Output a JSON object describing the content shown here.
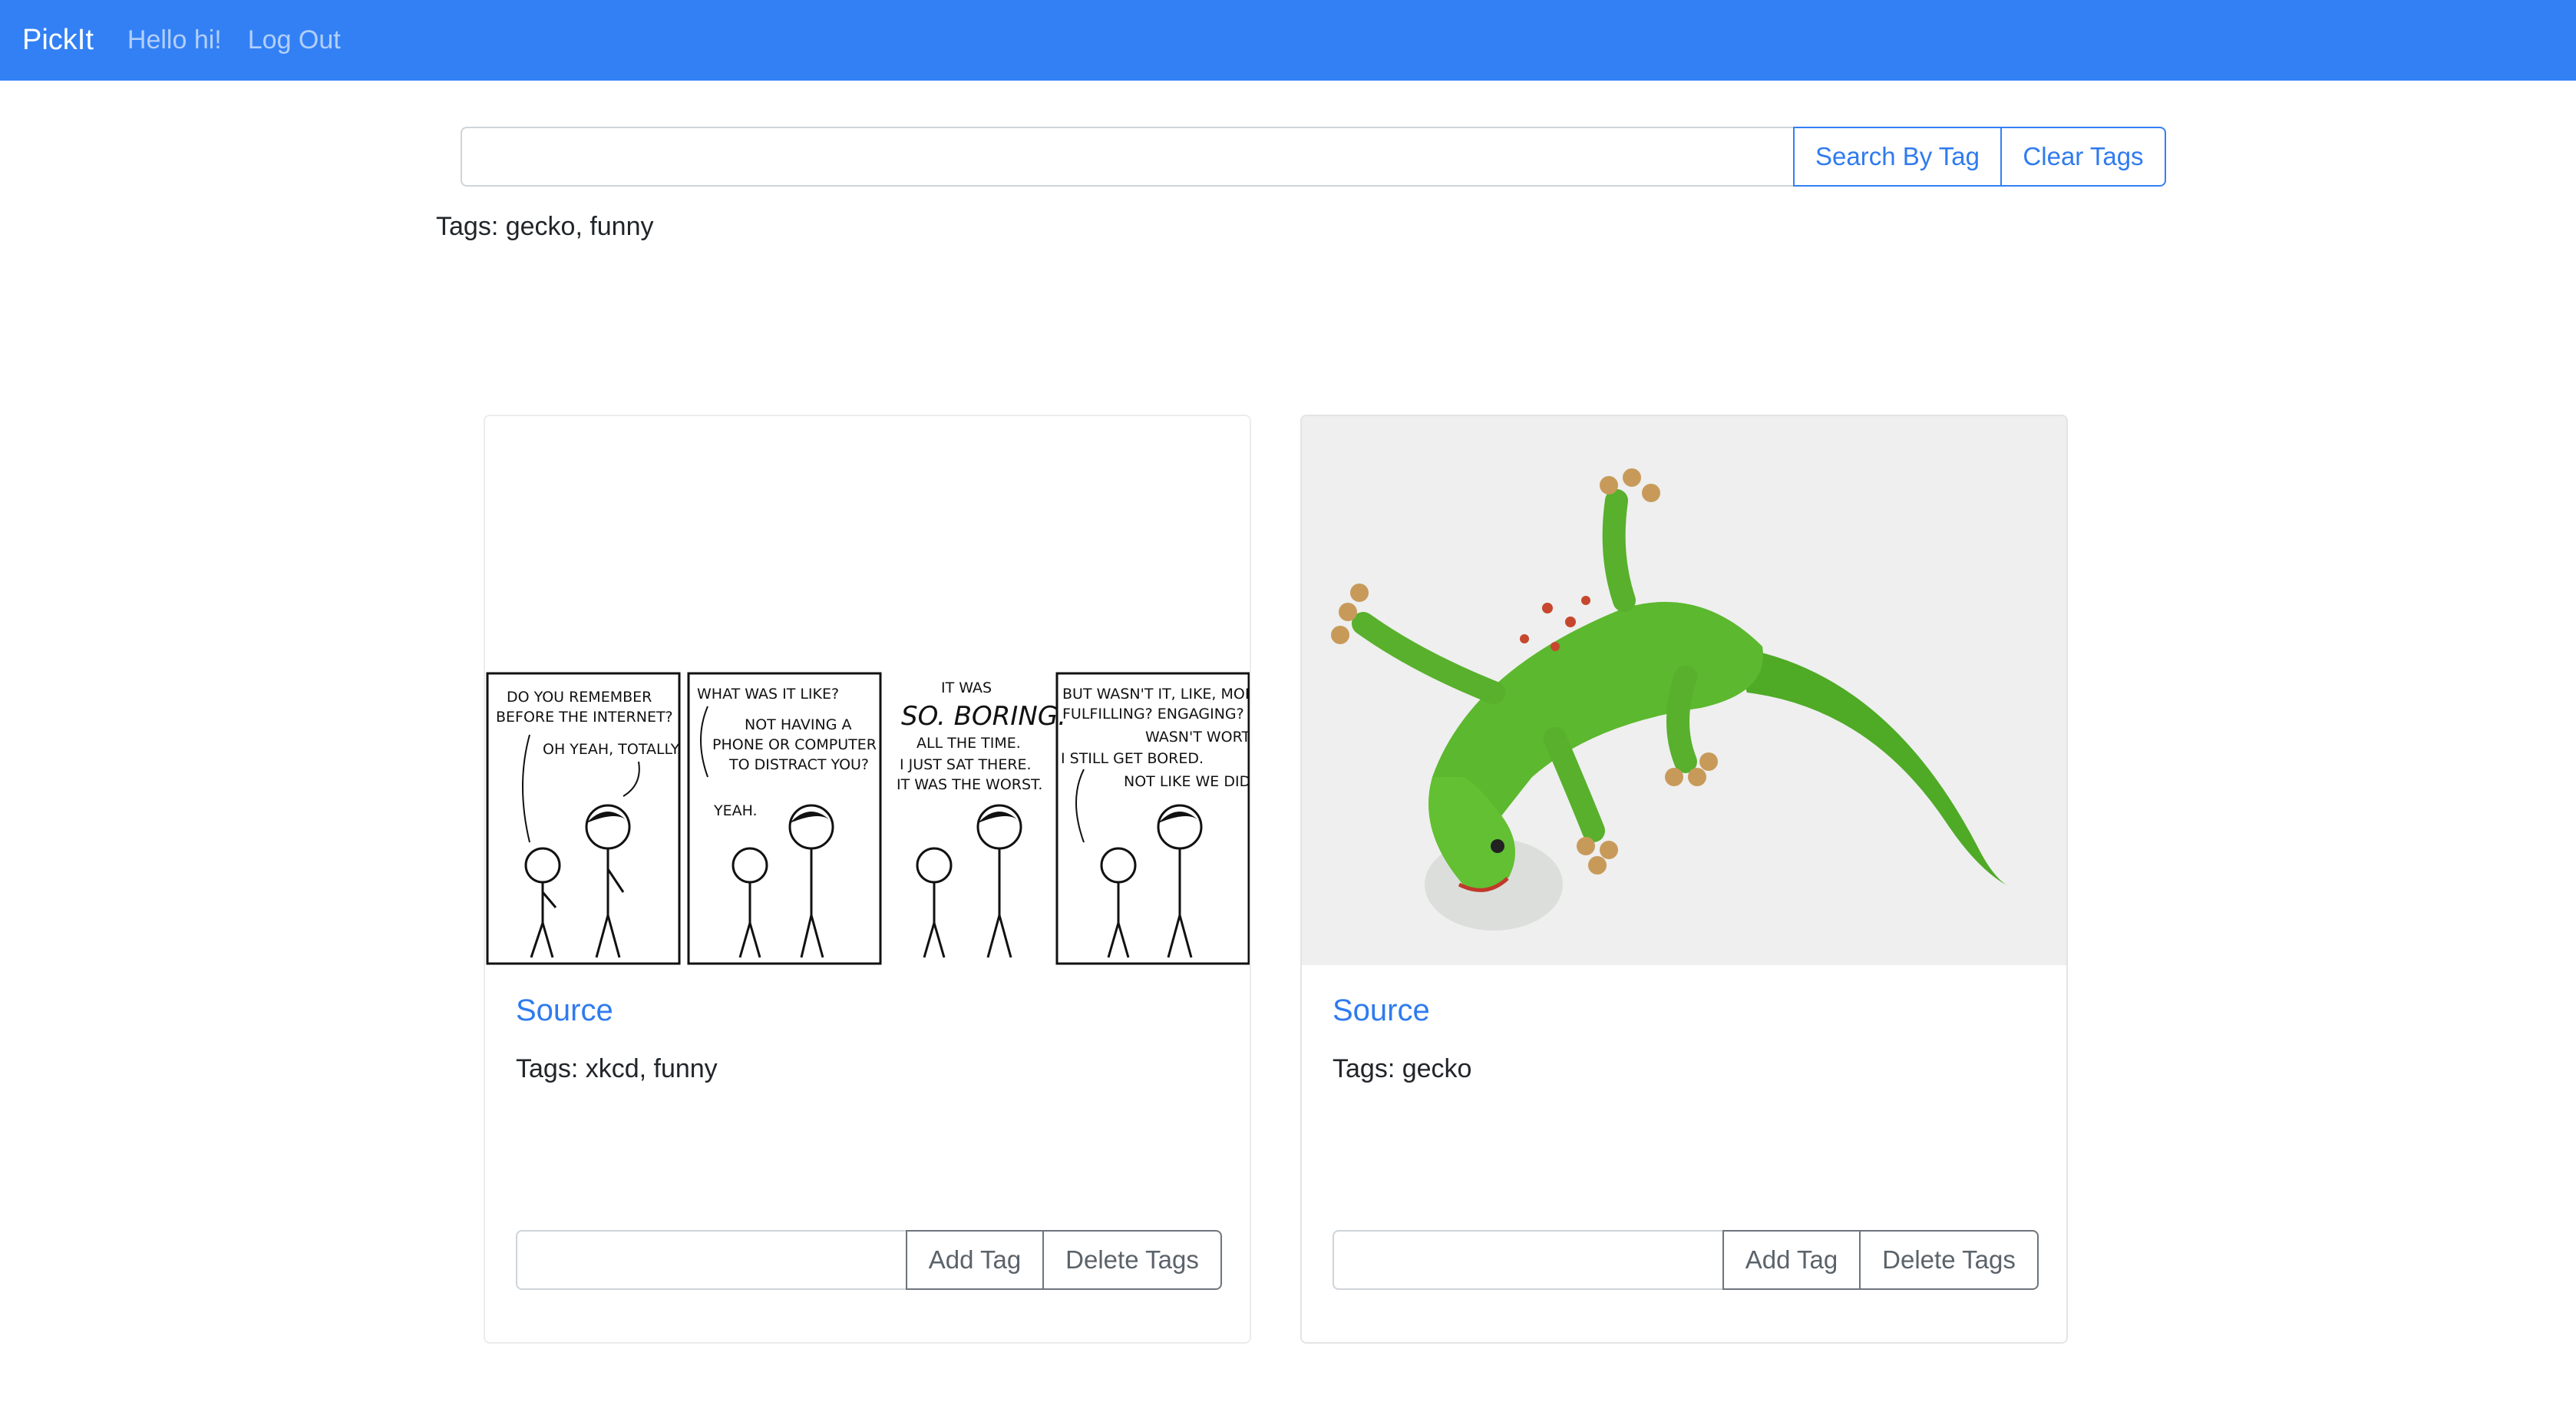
{
  "navbar": {
    "brand": "PickIt",
    "greeting": "Hello hi!",
    "logout": "Log Out"
  },
  "search": {
    "value": "",
    "placeholder": "",
    "search_label": "Search By Tag",
    "clear_label": "Clear Tags",
    "active_tags": "Tags: gecko, funny"
  },
  "cards": [
    {
      "image": "xkcd comic strip",
      "source_label": "Source",
      "tags": "Tags: xkcd, funny",
      "add_tag_label": "Add Tag",
      "delete_tags_label": "Delete Tags",
      "tag_input_value": "",
      "comic": {
        "panel1": [
          "DO YOU REMEMBER",
          "BEFORE THE INTERNET?",
          "OH YEAH, TOTALLY."
        ],
        "panel2": [
          "WHAT WAS IT LIKE?",
          "NOT HAVING A",
          "PHONE OR COMPUTER",
          "TO DISTRACT YOU?",
          "YEAH."
        ],
        "panel3_small": [
          "IT WAS"
        ],
        "panel3_big": "SO. BORING.",
        "panel3_rest": [
          "ALL THE TIME.",
          "I JUST SAT THERE.",
          "IT WAS THE WORST."
        ],
        "panel4": [
          "BUT WASN'T IT, LIKE, MORE",
          "FULFILLING? ENGAGING?",
          "WASN'T WORTH IT.",
          "I STILL GET BORED.",
          "NOT LIKE WE DID."
        ]
      }
    },
    {
      "image": "green gecko photo",
      "source_label": "Source",
      "tags": "Tags: gecko",
      "add_tag_label": "Add Tag",
      "delete_tags_label": "Delete Tags",
      "tag_input_value": ""
    }
  ],
  "colors": {
    "navbar": "#3380f5",
    "link": "#2f7bef",
    "gecko_green": "#5cb82e"
  }
}
